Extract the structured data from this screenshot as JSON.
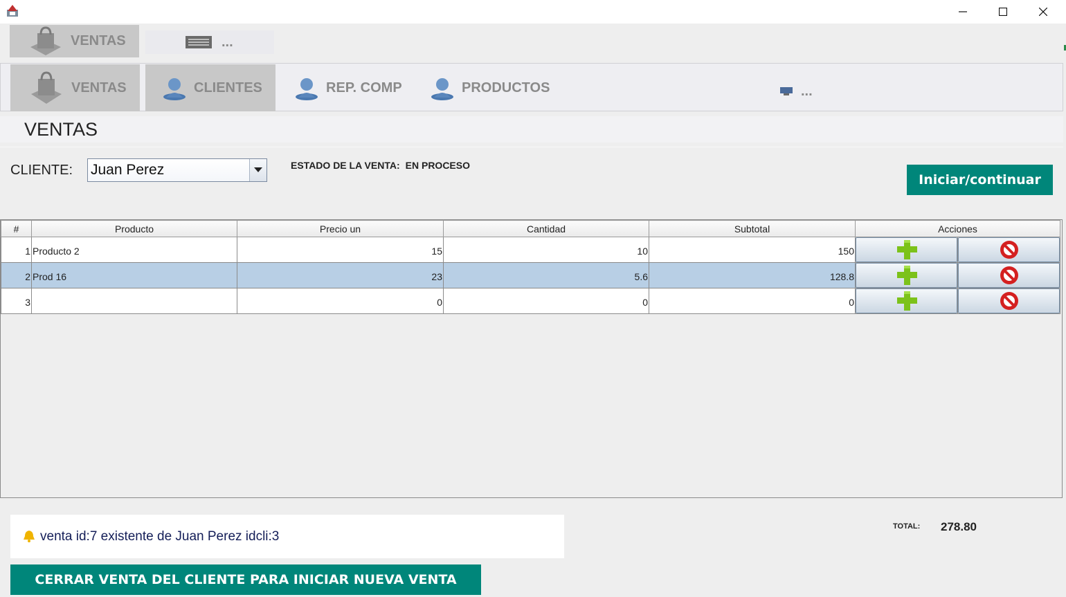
{
  "window": {
    "minimize": "—",
    "maximize": "☐",
    "close": "✕"
  },
  "nav_top": {
    "ventas_label": "VENTAS",
    "more_label": "..."
  },
  "nav_main": {
    "items": [
      {
        "label": "VENTAS",
        "icon": "shopping-bag-icon"
      },
      {
        "label": "CLIENTES",
        "icon": "user-icon"
      },
      {
        "label": "REP. COMP",
        "icon": "user-icon"
      },
      {
        "label": "PRODUCTOS",
        "icon": "user-icon"
      }
    ],
    "more_label": "..."
  },
  "section": {
    "title": "VENTAS"
  },
  "form": {
    "cliente_label": "CLIENTE:",
    "cliente_value": "Juan Perez",
    "estado_label": "ESTADO DE LA VENTA:",
    "estado_value": "EN PROCESO",
    "iniciar_label": "Iniciar/continuar"
  },
  "table": {
    "headers": [
      "#",
      "Producto",
      "Precio un",
      "Cantidad",
      "Subtotal",
      "Acciones"
    ],
    "rows": [
      {
        "n": "1",
        "producto": "Producto 2",
        "precio": "15",
        "cantidad": "10",
        "subtotal": "150"
      },
      {
        "n": "2",
        "producto": "Prod 16",
        "precio": "23",
        "cantidad": "5.6",
        "subtotal": "128.8"
      },
      {
        "n": "3",
        "producto": "",
        "precio": "0",
        "cantidad": "0",
        "subtotal": "0"
      }
    ],
    "selected_row": 2
  },
  "footer": {
    "message": "venta id:7  existente de Juan Perez idcli:3",
    "total_label": "TOTAL:",
    "total_value": "278.80",
    "cerrar_label": "CERRAR VENTA DEL CLIENTE PARA INICIAR NUEVA VENTA"
  },
  "colors": {
    "accent": "#00867a",
    "selected_row": "#b8cfe5",
    "nav_active": "#c8c8c8"
  }
}
